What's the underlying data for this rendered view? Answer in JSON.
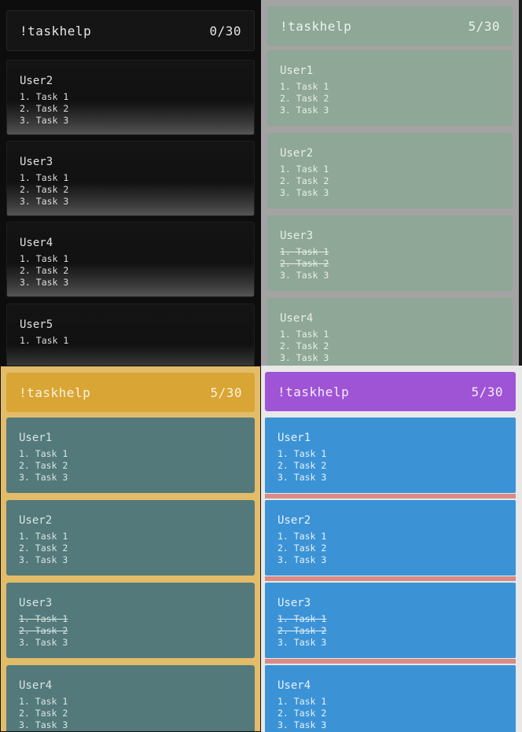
{
  "panels": [
    {
      "theme": "dark",
      "title": "!taskhelp",
      "count": "0/30",
      "cards": [
        {
          "user": "User2",
          "tasks": [
            "1. Task 1",
            "2. Task 2",
            "3. Task 3"
          ]
        },
        {
          "user": "User3",
          "tasks": [
            "1. Task 1",
            "2. Task 2",
            "3. Task 3"
          ]
        },
        {
          "user": "User4",
          "tasks": [
            "1. Task 1",
            "2. Task 2",
            "3. Task 3"
          ]
        },
        {
          "user": "User5",
          "tasks": [
            "1. Task 1"
          ]
        }
      ]
    },
    {
      "theme": "grey-green",
      "title": "!taskhelp",
      "count": "5/30",
      "cards": [
        {
          "user": "User1",
          "tasks": [
            "1. Task 1",
            "2. Task 2",
            "3. Task 3"
          ]
        },
        {
          "user": "User2",
          "tasks": [
            "1. Task 1",
            "2. Task 2",
            "3. Task 3"
          ]
        },
        {
          "user": "User3",
          "tasks": [
            "1. Task 1",
            "2. Task 2",
            "3. Task 3"
          ],
          "completed": [
            0,
            1
          ]
        },
        {
          "user": "User4",
          "tasks": [
            "1. Task 1",
            "2. Task 2",
            "3. Task 3"
          ]
        }
      ]
    },
    {
      "theme": "gold-teal",
      "title": "!taskhelp",
      "count": "5/30",
      "cards": [
        {
          "user": "User1",
          "tasks": [
            "1. Task 1",
            "2. Task 2",
            "3. Task 3"
          ]
        },
        {
          "user": "User2",
          "tasks": [
            "1. Task 1",
            "2. Task 2",
            "3. Task 3"
          ]
        },
        {
          "user": "User3",
          "tasks": [
            "1. Task 1",
            "2. Task 2",
            "3. Task 3"
          ],
          "completed": [
            0,
            1
          ]
        },
        {
          "user": "User4",
          "tasks": [
            "1. Task 1",
            "2. Task 2",
            "3. Task 3"
          ]
        }
      ]
    },
    {
      "theme": "purple-blue",
      "title": "!taskhelp",
      "count": "5/30",
      "cards": [
        {
          "user": "User1",
          "tasks": [
            "1. Task 1",
            "2. Task 2",
            "3. Task 3"
          ]
        },
        {
          "user": "User2",
          "tasks": [
            "1. Task 1",
            "2. Task 2",
            "3. Task 3"
          ]
        },
        {
          "user": "User3",
          "tasks": [
            "1. Task 1",
            "2. Task 2",
            "3. Task 3"
          ],
          "completed": [
            0,
            1
          ]
        },
        {
          "user": "User4",
          "tasks": [
            "1. Task 1",
            "2. Task 2",
            "3. Task 3"
          ]
        }
      ]
    }
  ]
}
